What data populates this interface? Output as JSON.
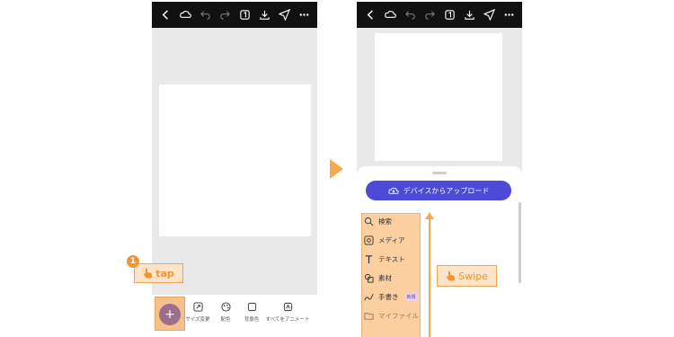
{
  "toolbar_icons": [
    "back-icon",
    "cloud-sync-icon",
    "undo-icon",
    "redo-icon",
    "pages-icon",
    "download-icon",
    "share-icon",
    "more-icon"
  ],
  "step_number": "1",
  "tap_label": "tap",
  "plus_label": "+",
  "bottom_tools": [
    {
      "label": "サイズ変更",
      "icon": "resize-icon"
    },
    {
      "label": "配色",
      "icon": "palette-icon"
    },
    {
      "label": "背景色",
      "icon": "background-icon"
    },
    {
      "label": "すべてをアニメート",
      "icon": "animate-icon"
    }
  ],
  "upload_button": "デバイスからアップロード",
  "menu": [
    {
      "label": "検索",
      "icon": "search-icon"
    },
    {
      "label": "メディア",
      "icon": "media-icon"
    },
    {
      "label": "テキスト",
      "icon": "text-icon"
    },
    {
      "label": "素材",
      "icon": "elements-icon"
    },
    {
      "label": "手書き",
      "icon": "draw-icon",
      "badge": "新規"
    },
    {
      "label": "マイファイル",
      "icon": "folder-icon"
    }
  ],
  "swipe_label": "Swipe",
  "colors": {
    "accent": "#f29632",
    "upload": "#4e4ad8",
    "plus": "#9a6f8a"
  }
}
